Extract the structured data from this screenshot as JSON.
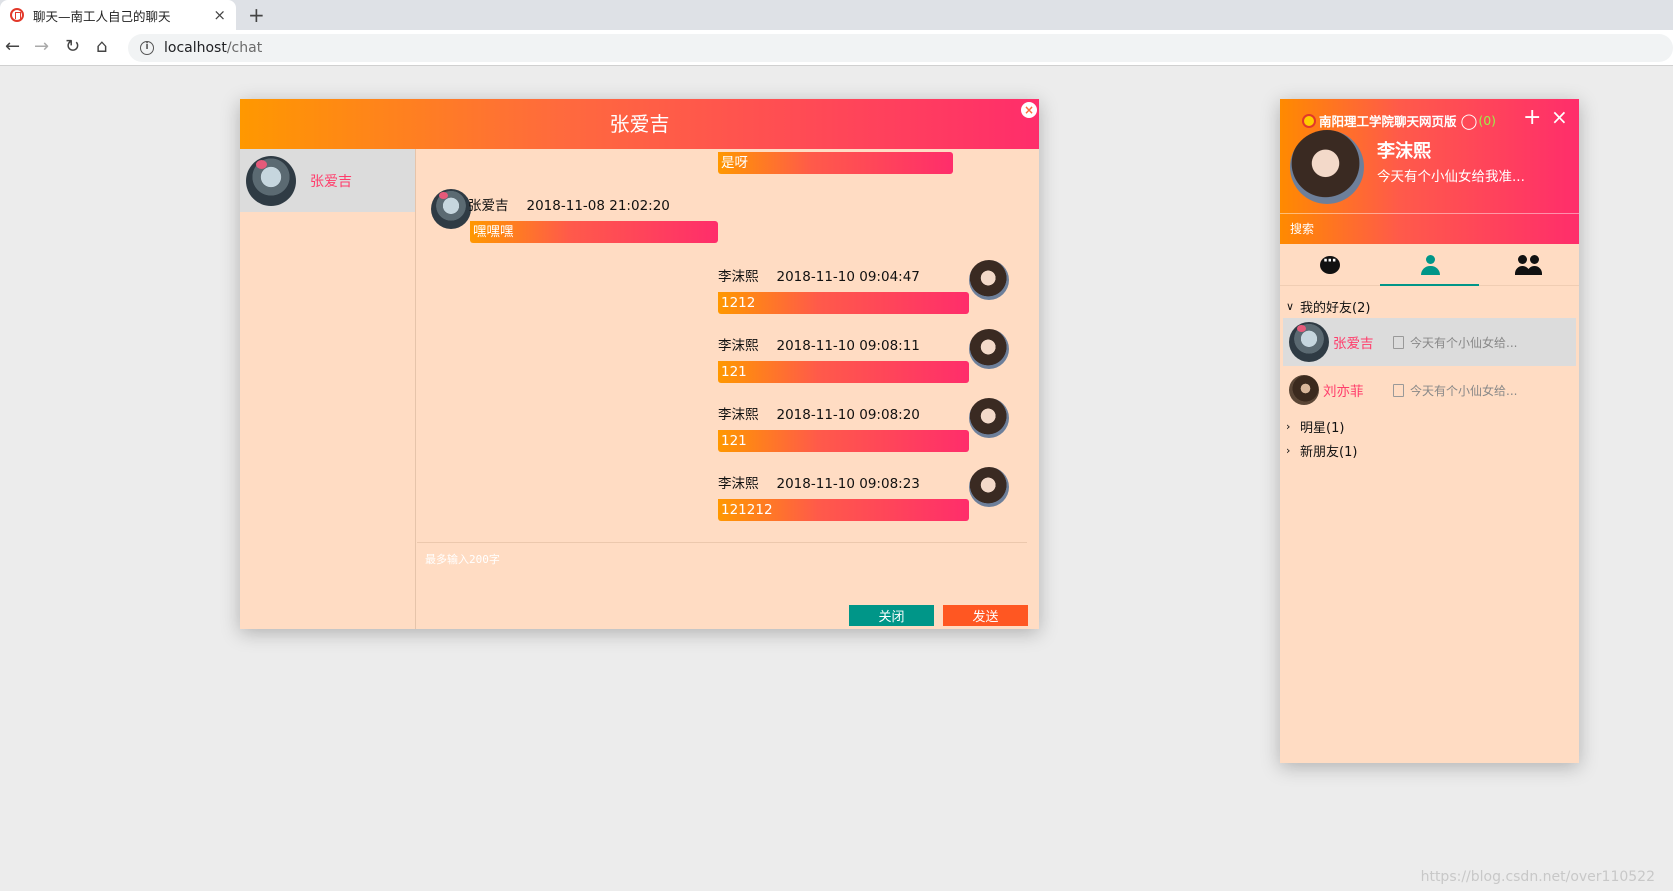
{
  "browser": {
    "tab_title": "聊天—南工人自己的聊天",
    "tab_close": "×",
    "new_tab": "+",
    "url_host": "localhost",
    "url_path": "/chat",
    "info_icon": "i",
    "back_icon": "arrow-left-icon",
    "forward_icon": "arrow-right-icon",
    "reload_icon": "reload-icon",
    "home_icon": "home-icon"
  },
  "chat_window": {
    "title": "张爱吉",
    "close_symbol": "×",
    "contacts": [
      {
        "name": "张爱吉"
      }
    ],
    "messages": [
      {
        "side": "right",
        "sender": "",
        "time": "",
        "text": "是呀"
      },
      {
        "side": "left",
        "sender": "张爱吉",
        "time": "2018-11-08 21:02:20",
        "text": "嘿嘿嘿"
      },
      {
        "side": "right",
        "sender": "李沫熙",
        "time": "2018-11-10 09:04:47",
        "text": "1212"
      },
      {
        "side": "right",
        "sender": "李沫熙",
        "time": "2018-11-10 09:08:11",
        "text": "121"
      },
      {
        "side": "right",
        "sender": "李沫熙",
        "time": "2018-11-10 09:08:20",
        "text": "121"
      },
      {
        "side": "right",
        "sender": "李沫熙",
        "time": "2018-11-10 09:08:23",
        "text": "121212"
      }
    ],
    "input_placeholder": "最多输入200字",
    "close_button": "关闭",
    "send_button": "发送"
  },
  "main_panel": {
    "brand": "南阳理工学院聊天网页版",
    "user_icon": "user-icon",
    "online_count": "(0)",
    "add_symbol": "+",
    "close_symbol": "×",
    "user_name": "李沫熙",
    "user_sign": "今天有个小仙女给我准...",
    "search_placeholder": "搜索",
    "tabs": [
      {
        "icon": "chat-icon"
      },
      {
        "icon": "user-icon",
        "active": true
      },
      {
        "icon": "group-icon"
      }
    ],
    "groups": [
      {
        "label": "我的好友(2)",
        "expanded": true
      },
      {
        "label": "明星(1)",
        "expanded": false
      },
      {
        "label": "新朋友(1)",
        "expanded": false
      }
    ],
    "friends": [
      {
        "name": "张爱吉",
        "sign": "今天有个小仙女给..."
      },
      {
        "name": "刘亦菲",
        "sign": "今天有个小仙女给..."
      }
    ]
  },
  "watermark": "https://blog.csdn.net/over110522",
  "colors": {
    "header_gradient_start": "#ff9800",
    "header_gradient_end": "#ff2d6b",
    "panel_bg": "#ffdcc3",
    "close_button": "#009688",
    "send_button": "#ff5722",
    "name_pink": "#ff3d6b"
  }
}
